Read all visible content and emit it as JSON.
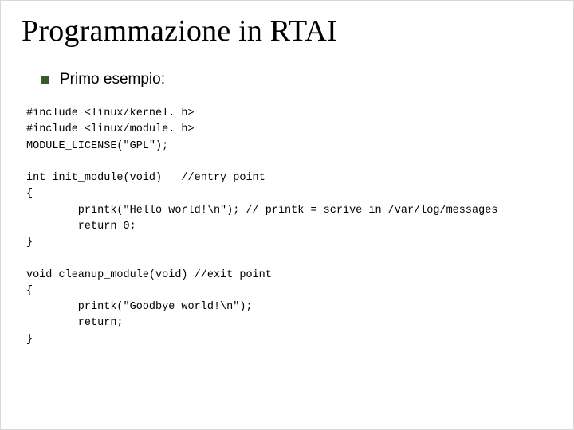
{
  "title": "Programmazione in RTAI",
  "bullet": "Primo esempio:",
  "code": "#include <linux/kernel. h>\n#include <linux/module. h>\nMODULE_LICENSE(\"GPL\");\n\nint init_module(void)   //entry point\n{\n        printk(\"Hello world!\\n\"); // printk = scrive in /var/log/messages\n        return 0;\n}\n\nvoid cleanup_module(void) //exit point\n{\n        printk(\"Goodbye world!\\n\");\n        return;\n}"
}
